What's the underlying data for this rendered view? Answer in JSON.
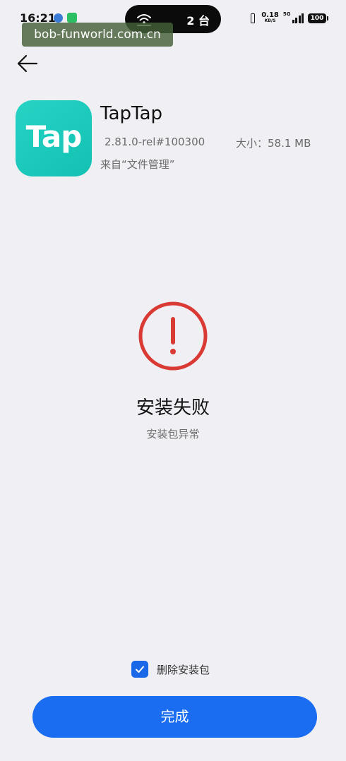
{
  "status_bar": {
    "time": "16:21",
    "active_devices": "2 台",
    "net_speed_value": "0.18",
    "net_speed_unit": "KB/S",
    "network_type": "5G",
    "battery_level": "100"
  },
  "watermark": "bob-funworld.com.cn",
  "app": {
    "icon_text": "Tap",
    "name": "TapTap",
    "version": "2.81.0-rel#100300",
    "size": "大小：58.1 MB",
    "source": "来自“文件管理”",
    "icon_color": "#1fcbbd"
  },
  "result": {
    "title": "安装失败",
    "subtitle": "安装包异常",
    "error_color": "#d93a34"
  },
  "delete_option": {
    "label": "删除安装包",
    "checked": true
  },
  "done_button": {
    "label": "完成",
    "color": "#1a6cf0"
  },
  "icons": {
    "back": "arrow-left-icon",
    "error": "exclamation-circle-icon",
    "checkbox": "checkmark-icon",
    "wifi": "wifi-icon",
    "vibrate": "vibrate-icon",
    "signal": "signal-bars-icon",
    "battery": "battery-icon"
  }
}
